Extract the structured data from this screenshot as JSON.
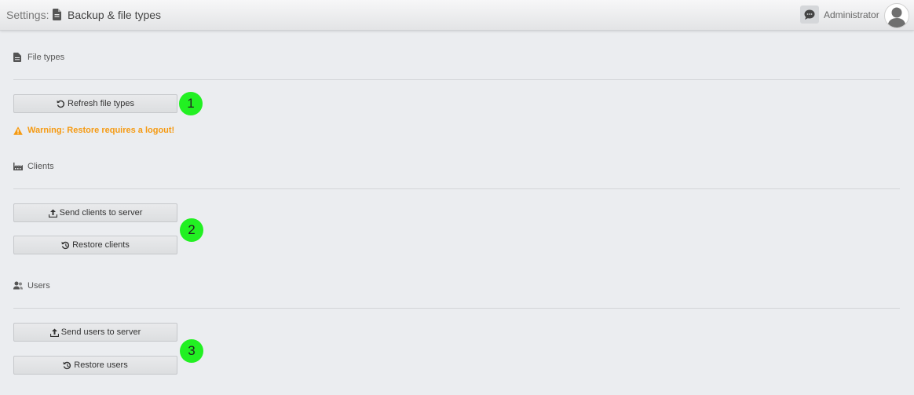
{
  "header": {
    "breadcrumb_prefix": "Settings:",
    "page_title": "Backup & file types",
    "user_name": "Administrator"
  },
  "sections": {
    "file_types": {
      "title": "File types",
      "refresh_button": "Refresh file types",
      "badge": "1"
    },
    "warning": "Warning: Restore requires a logout!",
    "clients": {
      "title": "Clients",
      "send_button": "Send clients to server",
      "restore_button": "Restore clients",
      "badge": "2"
    },
    "users": {
      "title": "Users",
      "send_button": "Send users to server",
      "restore_button": "Restore users",
      "badge": "3"
    }
  },
  "colors": {
    "background": "#ebedf0",
    "warning": "#f59a12",
    "badge": "#22f022"
  },
  "icons": {
    "page": "file-icon",
    "chat": "chat-icon",
    "avatar": "user-avatar-icon",
    "file_types": "file-icon",
    "refresh": "refresh-icon",
    "warning": "warning-icon",
    "clients": "factory-icon",
    "upload": "upload-icon",
    "restore": "history-icon",
    "users": "users-icon"
  }
}
